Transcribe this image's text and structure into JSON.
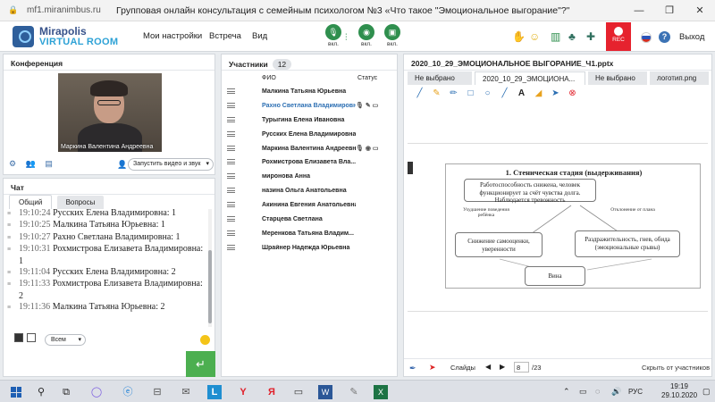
{
  "browser": {
    "url": "mf1.miranimbus.ru",
    "title": "Групповая онлайн консультация с семейным психологом №3 «Что такое \"Эмоциональное выгорание\"?\"",
    "min": "—",
    "max": "❐",
    "close": "✕"
  },
  "app": {
    "logo_line1": "Mirapolis",
    "logo_line2": "VIRTUAL ROOM",
    "menu": [
      "Мои настройки",
      "Встреча",
      "Вид"
    ],
    "controls": [
      {
        "label": "вкл.",
        "icon": "microphone-icon"
      },
      {
        "label": "вкл.",
        "icon": "webcam-icon"
      },
      {
        "label": "вкл.",
        "icon": "screen-share-icon"
      }
    ],
    "rec_label": "REC",
    "help": "?",
    "exit": "Выход"
  },
  "conference": {
    "title": "Конференция",
    "video_caption": "Маркина Валентина  Андреевна",
    "start_video": "Запустить видео и звук"
  },
  "chat": {
    "title": "Чат",
    "tabs": [
      "Общий",
      "Вопросы"
    ],
    "messages": [
      {
        "time": "19:10:24",
        "text": "Русских Елена Владимировна: 1"
      },
      {
        "time": "19:10:25",
        "text": "Малкина Татьяна  Юрьевна: 1"
      },
      {
        "time": "19:10:27",
        "text": "Рахно Светлана  Владимировна: 1"
      },
      {
        "time": "19:10:31",
        "text": "Рохмистрова  Елизавета Владимировна: 1"
      },
      {
        "time": "19:11:04",
        "text": "Русских Елена Владимировна: 2"
      },
      {
        "time": "19:11:33",
        "text": "Рохмистрова  Елизавета Владимировна: 2"
      },
      {
        "time": "19:11:36",
        "text": "Малкина Татьяна  Юрьевна: 2"
      }
    ],
    "recipient": "Всем",
    "send": "↵"
  },
  "participants": {
    "title": "Участники",
    "count": "12",
    "col_name": "ФИО",
    "col_status": "Статус",
    "list": [
      {
        "name": "Малкина Татьяна  Юрьевна",
        "status": ""
      },
      {
        "name": "Рахно Светлана  Владимировна",
        "status": "🎙 ✎ ▭"
      },
      {
        "name": "Турыгина  Елена  Ивановна",
        "status": ""
      },
      {
        "name": "Русских Елена Владимировна",
        "status": ""
      },
      {
        "name": "Маркина Валентина  Андреевна",
        "status": "🎙 ◉ ▭"
      },
      {
        "name": "Рохмистрова  Елизавета Вла...",
        "status": ""
      },
      {
        "name": "миронова  Анна",
        "status": ""
      },
      {
        "name": "назина  Ольга  Анатольевна",
        "status": ""
      },
      {
        "name": "Акинина  Евгения Анатольевна",
        "status": ""
      },
      {
        "name": "Старцева  Светлана",
        "status": ""
      },
      {
        "name": "Меренкова  Татьяна  Владим...",
        "status": ""
      },
      {
        "name": "Шрайнер Надежда  Юрьевна",
        "status": ""
      }
    ]
  },
  "presentation": {
    "title": "2020_10_29_ЭМОЦИОНАЛЬНОЕ ВЫГОРАНИЕ_Ч1.pptx",
    "tabs": [
      "Не выбрано",
      "2020_10_29_ЭМОЦИОНА...",
      "Не выбрано",
      "логотип.png"
    ],
    "slide": {
      "title": "1. Стеническая стадия (выдерживания)",
      "box_top": "Работоспособность снижена, человек функционирует за счёт чувства долга. Наблюдается тревожность",
      "box_left": "Снижение самооценки, уверенности",
      "box_right": "Раздражительность, гнев, обида (эмоциональные срывы)",
      "box_bottom": "Вина",
      "label_left": "Ухудшение поведения ребёнка",
      "label_right": "Отклонение от плана"
    },
    "slides_label": "Слайды",
    "page": "8",
    "total": "/23",
    "hide_participants": "Скрыть от участников"
  },
  "taskbar": {
    "lang": "РУС",
    "time": "19:19",
    "date": "29.10.2020"
  },
  "colors": {
    "accent_blue": "#2c6fb3",
    "green": "#4caf50",
    "rec_red": "#e6222e"
  }
}
